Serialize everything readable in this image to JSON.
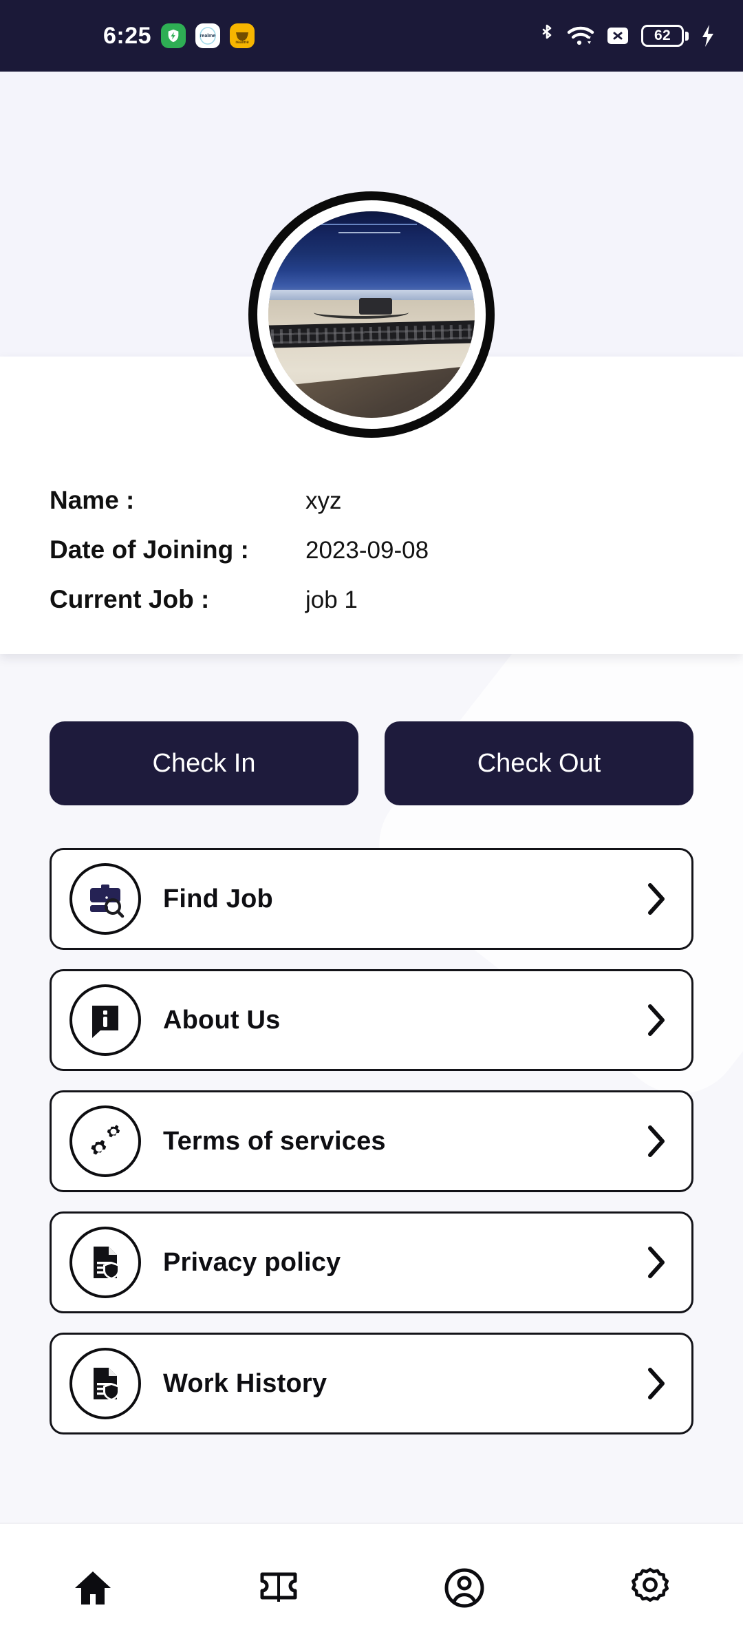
{
  "status_bar": {
    "time": "6:25",
    "app_icons": [
      {
        "name": "security-shield-icon",
        "label": ""
      },
      {
        "name": "realme-store-icon",
        "label": "realme"
      },
      {
        "name": "realme-yellow-icon",
        "label": "realme"
      }
    ],
    "bluetooth_icon": "bluetooth-icon",
    "wifi_icon": "wifi-icon",
    "sim_icon": "no-sim-icon",
    "battery_level": "62",
    "charging_icon": "charging-bolt-icon",
    "background_color": "#1b1938"
  },
  "profile": {
    "avatar_name": "profile-avatar",
    "rows": [
      {
        "label": "Name :",
        "value": "xyz"
      },
      {
        "label": "Date of Joining :",
        "value": "2023-09-08"
      },
      {
        "label": "Current Job :",
        "value": "job 1"
      }
    ]
  },
  "actions": {
    "check_in_label": "Check In",
    "check_out_label": "Check Out",
    "button_color": "#1e1b3c"
  },
  "menu": {
    "items": [
      {
        "label": "Find Job",
        "icon": "briefcase-search-icon"
      },
      {
        "label": "About Us",
        "icon": "info-speech-bubble-icon"
      },
      {
        "label": "Terms of services",
        "icon": "gears-icon"
      },
      {
        "label": "Privacy policy",
        "icon": "document-shield-icon"
      },
      {
        "label": "Work History",
        "icon": "document-shield-icon"
      }
    ],
    "chevron_icon": "chevron-right-icon"
  },
  "bottom_nav": {
    "items": [
      {
        "name": "home",
        "icon": "home-icon",
        "active": true
      },
      {
        "name": "tickets",
        "icon": "ticket-icon",
        "active": false
      },
      {
        "name": "profile",
        "icon": "user-circle-icon",
        "active": false
      },
      {
        "name": "settings",
        "icon": "gear-icon",
        "active": false
      }
    ]
  }
}
